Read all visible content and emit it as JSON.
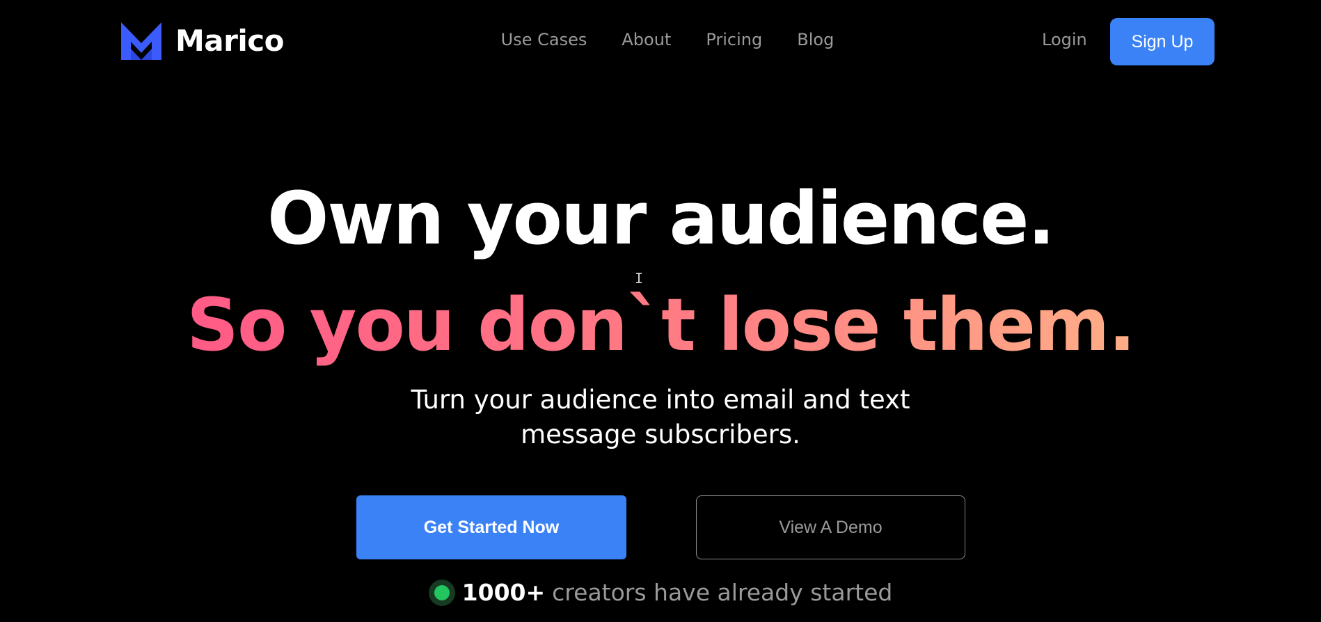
{
  "brand": {
    "name": "Marico",
    "logo_icon": "m-chevron-logo-icon",
    "logo_color": "#3b5bfd"
  },
  "nav": {
    "items": [
      {
        "label": "Use Cases"
      },
      {
        "label": "About"
      },
      {
        "label": "Pricing"
      },
      {
        "label": "Blog"
      }
    ],
    "login_label": "Login",
    "signup_label": "Sign Up"
  },
  "hero": {
    "headline": "Own your audience.",
    "subheadline": "So you don`t lose them.",
    "description_line1": "Turn your audience into email and text",
    "description_line2": "message subscribers.",
    "primary_cta": "Get Started Now",
    "secondary_cta": "View A Demo",
    "social_proof_count": "1000+",
    "social_proof_text": "creators have already started"
  },
  "colors": {
    "accent": "#3b82f6",
    "gradient_start": "#ff5a86",
    "gradient_end": "#ffae86",
    "status_dot": "#22c55e"
  },
  "cursor_icon": "text-cursor-icon"
}
